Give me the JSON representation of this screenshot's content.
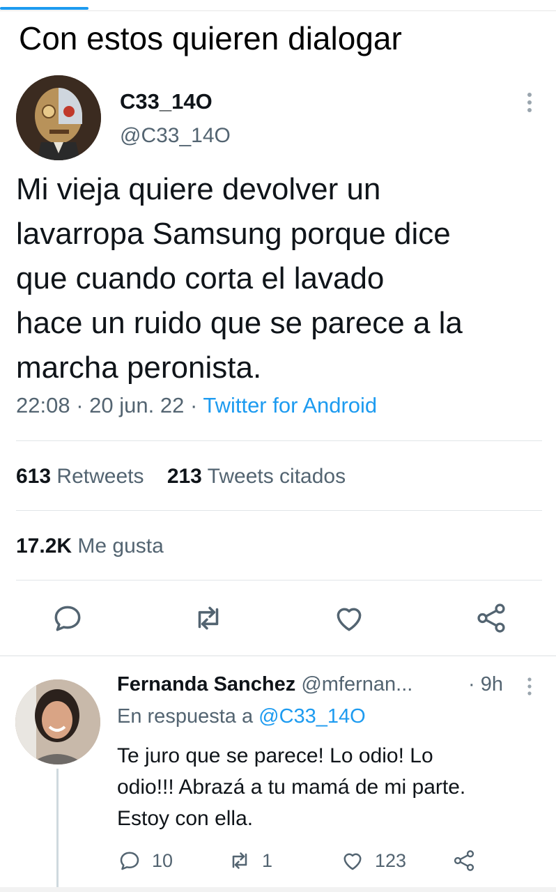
{
  "caption": "Con estos quieren dialogar",
  "tweet": {
    "display_name": "C33_14O",
    "handle": "@C33_14O",
    "text": "Mi vieja quiere devolver un\nlavarropa Samsung porque dice\nque cuando corta el lavado\nhace un ruido que se parece a la\nmarcha peronista.",
    "time": "22:08",
    "date": "20 jun. 22",
    "separator": "·",
    "source": "Twitter for Android",
    "retweets_count": "613",
    "retweets_label": "Retweets",
    "quotes_count": "213",
    "quotes_label": "Tweets citados",
    "likes_count": "17.2K",
    "likes_label": "Me gusta"
  },
  "reply": {
    "display_name": "Fernanda Sanchez",
    "handle": "@mfernan...",
    "time": "· 9h",
    "replying_label": "En respuesta a",
    "replying_to": "@C33_14O",
    "text": "Te juro que se parece! Lo odio! Lo\nodio!!! Abrazá a tu mamá de mi parte.\nEstoy con ella.",
    "replies": "10",
    "retweets": "1",
    "likes": "123"
  },
  "icons": [
    "reply-icon",
    "retweet-icon",
    "like-icon",
    "share-icon",
    "more-options-icon"
  ],
  "colors": {
    "accent": "#1d9bf0",
    "text": "#0f1419",
    "muted": "#536471",
    "divider": "#e1e5e8"
  }
}
